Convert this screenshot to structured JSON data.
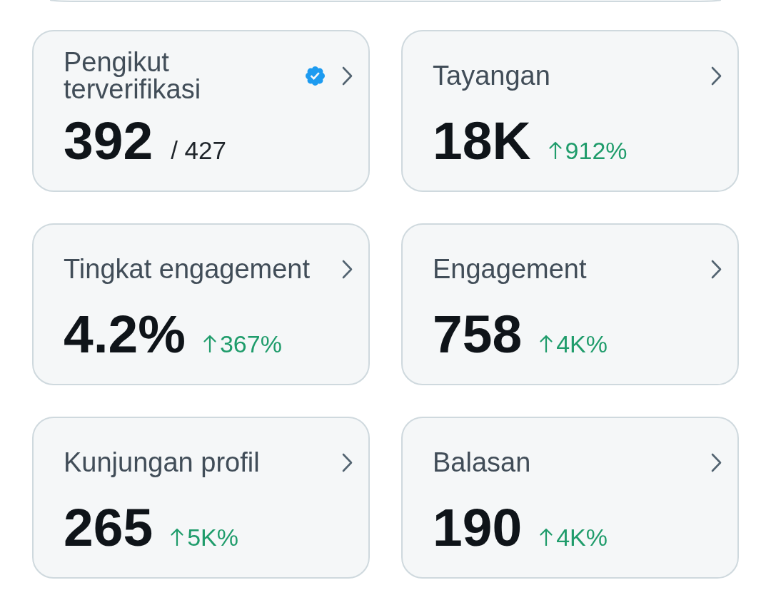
{
  "cards": [
    {
      "title": "Pengikut terverifikasi",
      "verified": true,
      "value": "392",
      "secondary": {
        "kind": "total",
        "text": "/ 427"
      }
    },
    {
      "title": "Tayangan",
      "verified": false,
      "value": "18K",
      "secondary": {
        "kind": "change",
        "up": true,
        "text": "912%"
      }
    },
    {
      "title": "Tingkat engagement",
      "verified": false,
      "value": "4.2%",
      "secondary": {
        "kind": "change",
        "up": true,
        "text": "367%"
      }
    },
    {
      "title": "Engagement",
      "verified": false,
      "value": "758",
      "secondary": {
        "kind": "change",
        "up": true,
        "text": "4K%"
      }
    },
    {
      "title": "Kunjungan profil",
      "verified": false,
      "value": "265",
      "secondary": {
        "kind": "change",
        "up": true,
        "text": "5K%"
      }
    },
    {
      "title": "Balasan",
      "verified": false,
      "value": "190",
      "secondary": {
        "kind": "change",
        "up": true,
        "text": "4K%"
      }
    }
  ]
}
